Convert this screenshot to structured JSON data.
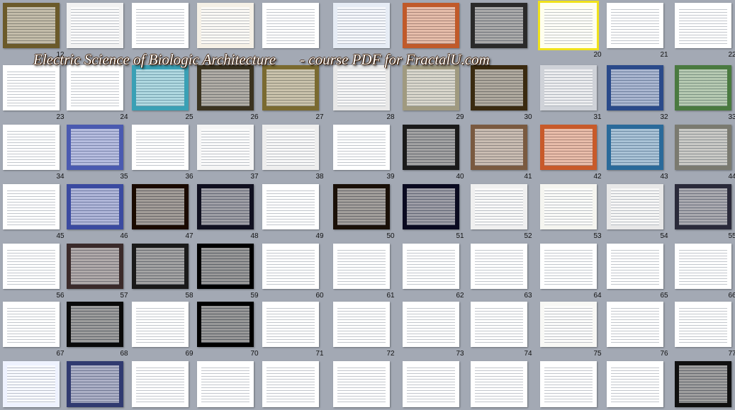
{
  "window": {
    "title": ""
  },
  "banner": {
    "title": "Electric Science of Biologic Architecture",
    "subtitle": "- course PDF for  FractalU.com"
  },
  "selected_slide": "20",
  "rows": [
    {
      "labels": [
        "",
        "",
        "",
        "",
        "",
        "",
        "",
        "",
        "",
        "",
        "",
        ""
      ],
      "first_label": "12",
      "label_list": [
        "12",
        "",
        "",
        "",
        "",
        "",
        "",
        "",
        "20",
        "21",
        "22"
      ],
      "colors": [
        "#6b5a2a",
        "#f2f2f2",
        "#ffffff",
        "#f5f0e6",
        "#ffffff",
        "#e6ecf5",
        "#c05a2a",
        "#2a2a2a",
        "#ffffee",
        "#ffffff",
        "#ffffff"
      ]
    },
    {
      "label_list": [
        "23",
        "24",
        "25",
        "26",
        "27",
        "28",
        "29",
        "30",
        "31",
        "32",
        "33"
      ],
      "colors": [
        "#ffffff",
        "#ffffff",
        "#3aa0b5",
        "#3b3320",
        "#7a6a30",
        "#e8e8e8",
        "#a09a80",
        "#3a2a10",
        "#cfd2d8",
        "#2a4a8a",
        "#4a7a40"
      ]
    },
    {
      "label_list": [
        "34",
        "35",
        "36",
        "37",
        "38",
        "39",
        "40",
        "41",
        "42",
        "43",
        "44"
      ],
      "colors": [
        "#ffffff",
        "#4a5ab0",
        "#ffffff",
        "#f5f5f5",
        "#eeeeee",
        "#ffffff",
        "#1a1a1a",
        "#7a5a40",
        "#c85a2a",
        "#2a6a9a",
        "#7a7a70"
      ]
    },
    {
      "label_list": [
        "45",
        "46",
        "47",
        "48",
        "49",
        "50",
        "51",
        "52",
        "53",
        "54",
        "55"
      ],
      "colors": [
        "#ffffff",
        "#3a4aa0",
        "#1a0a00",
        "#101020",
        "#ffffff",
        "#1a1008",
        "#0a0a20",
        "#f0f0f0",
        "#f5f5f0",
        "#e8e8e8",
        "#2a2a3a"
      ]
    },
    {
      "label_list": [
        "56",
        "57",
        "58",
        "59",
        "60",
        "61",
        "62",
        "63",
        "64",
        "65",
        "66"
      ],
      "colors": [
        "#ffffff",
        "#3a2a2a",
        "#1a1a1a",
        "#000000",
        "#ffffff",
        "#ffffff",
        "#ffffff",
        "#ffffff",
        "#ffffff",
        "#ffffff",
        "#ffffff"
      ]
    },
    {
      "label_list": [
        "67",
        "68",
        "69",
        "70",
        "71",
        "72",
        "73",
        "74",
        "75",
        "76",
        "77"
      ],
      "colors": [
        "#ffffff",
        "#0a0a0a",
        "#ffffff",
        "#000000",
        "#ffffff",
        "#ffffff",
        "#ffffff",
        "#ffffff",
        "#f8f8f5",
        "#ffffff",
        "#ffffff"
      ]
    },
    {
      "label_list": [
        "",
        "",
        "",
        "",
        "",
        "",
        "",
        "",
        "",
        "",
        ""
      ],
      "colors": [
        "#eef2ff",
        "#303a70",
        "#ffffff",
        "#ffffff",
        "#ffffff",
        "#ffffff",
        "#ffffff",
        "#ffffff",
        "#ffffff",
        "#ffffff",
        "#101010"
      ]
    }
  ]
}
